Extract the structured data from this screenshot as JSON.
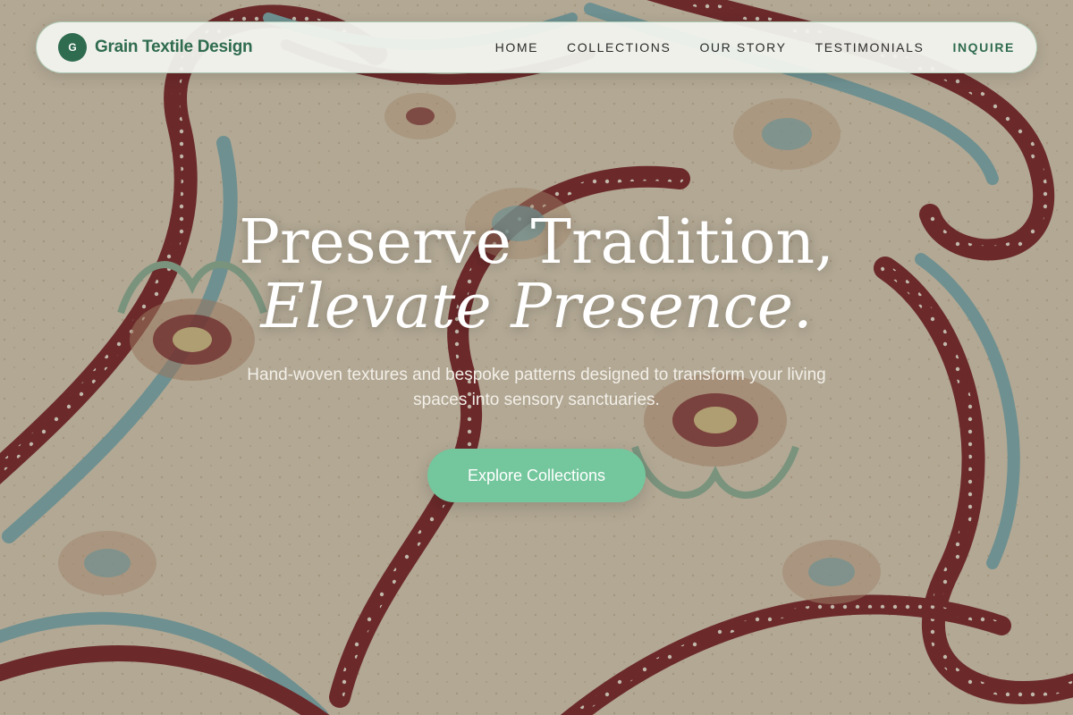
{
  "brand": {
    "mark": "G",
    "name": "Grain Textile Design"
  },
  "nav": {
    "items": [
      {
        "label": "HOME"
      },
      {
        "label": "COLLECTIONS"
      },
      {
        "label": "OUR STORY"
      },
      {
        "label": "TESTIMONIALS"
      },
      {
        "label": "INQUIRE"
      }
    ]
  },
  "hero": {
    "title_line1": "Preserve Tradition,",
    "title_line2": "Elevate Presence.",
    "subtitle": "Hand-woven textures and bespoke patterns designed to transform your living spaces into sensory sanctuaries.",
    "cta_label": "Explore Collections",
    "background": "paisley-textile-image"
  },
  "colors": {
    "accent": "#2f6b4f",
    "cta": "#74c69d",
    "maroon": "#7b2228",
    "teal": "#7fb0b5",
    "cream": "#e2d6bf"
  }
}
